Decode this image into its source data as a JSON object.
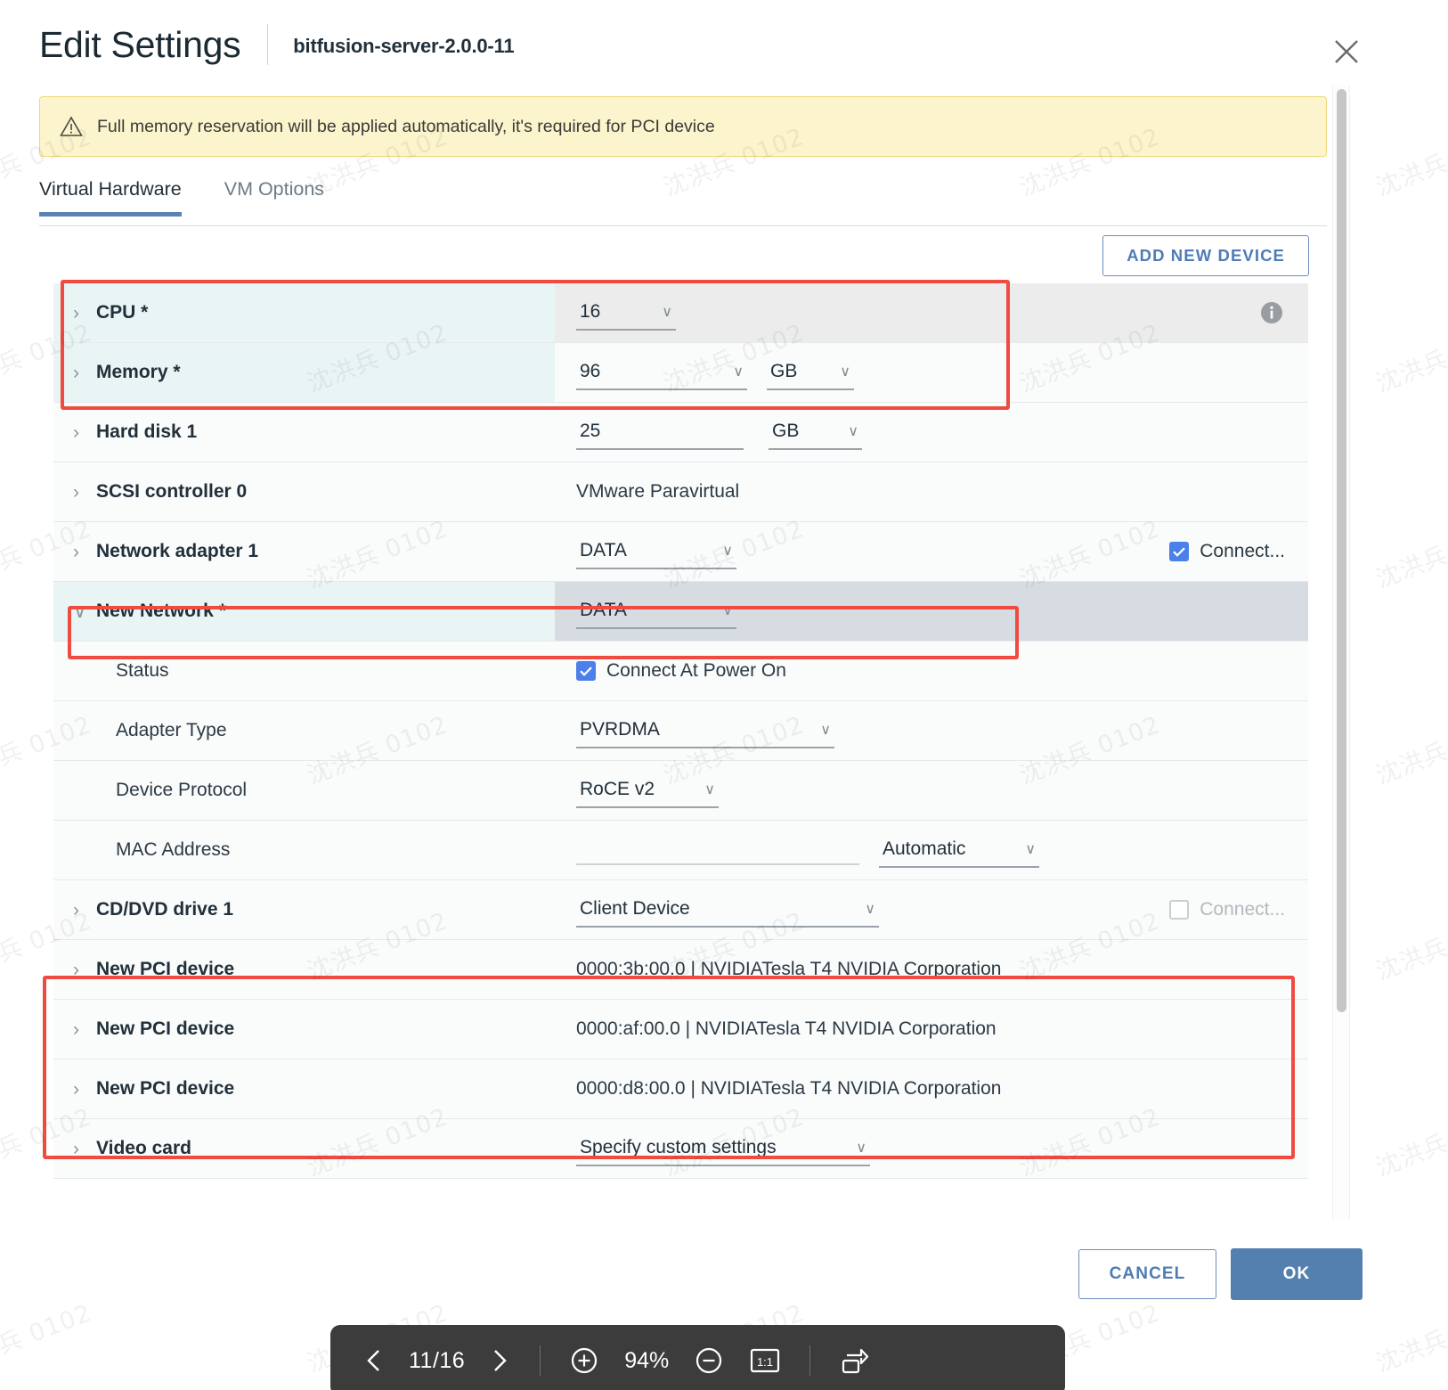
{
  "header": {
    "title": "Edit Settings",
    "subtitle": "bitfusion-server-2.0.0-11",
    "close_icon": "close-icon"
  },
  "alert": {
    "icon": "warning-triangle-icon",
    "text": "Full memory reservation will be applied automatically, it's required for PCI device"
  },
  "tabs": [
    {
      "label": "Virtual Hardware",
      "active": true
    },
    {
      "label": "VM Options",
      "active": false
    }
  ],
  "toolbar_top": {
    "add_new_device": "ADD NEW DEVICE"
  },
  "rows": {
    "cpu": {
      "label": "CPU *",
      "caret": "›",
      "value": "16",
      "chevron": "∨",
      "info_icon": "info-icon"
    },
    "memory": {
      "label": "Memory *",
      "caret": "›",
      "value": "96",
      "chevron": "∨",
      "unit": "GB",
      "unit_chevron": "∨"
    },
    "harddisk": {
      "label": "Hard disk 1",
      "caret": "›",
      "value": "25",
      "unit": "GB",
      "unit_chevron": "∨"
    },
    "scsi": {
      "label": "SCSI controller 0",
      "caret": "›",
      "value": "VMware Paravirtual"
    },
    "netadapter": {
      "label": "Network adapter 1",
      "caret": "›",
      "value": "DATA",
      "chevron": "∨",
      "connect_label": "Connect...",
      "connect_checked": true
    },
    "newnetwork": {
      "label": "New Network *",
      "caret": "∨",
      "value": "DATA",
      "chevron": "∨"
    },
    "status": {
      "label": "Status",
      "checkbox_label": "Connect At Power On",
      "checked": true
    },
    "adapter_type": {
      "label": "Adapter Type",
      "value": "PVRDMA",
      "chevron": "∨"
    },
    "device_protocol": {
      "label": "Device Protocol",
      "value": "RoCE v2",
      "chevron": "∨"
    },
    "mac_address": {
      "label": "MAC Address",
      "mac_value": "",
      "mode": "Automatic",
      "chevron": "∨"
    },
    "cddvd": {
      "label": "CD/DVD drive 1",
      "caret": "›",
      "value": "Client Device",
      "chevron": "∨",
      "connect_label": "Connect...",
      "connect_checked": false
    },
    "pci1": {
      "label": "New PCI device",
      "caret": "›",
      "value": "0000:3b:00.0 | NVIDIATesla T4 NVIDIA Corporation"
    },
    "pci2": {
      "label": "New PCI device",
      "caret": "›",
      "value": "0000:af:00.0 | NVIDIATesla T4 NVIDIA Corporation"
    },
    "pci3": {
      "label": "New PCI device",
      "caret": "›",
      "value": "0000:d8:00.0 | NVIDIATesla T4 NVIDIA Corporation"
    },
    "videocard": {
      "label": "Video card",
      "caret": "›",
      "value": "Specify custom settings",
      "chevron": "∨"
    }
  },
  "footer": {
    "cancel": "CANCEL",
    "ok": "OK"
  },
  "viewer_toolbar": {
    "prev_icon": "chevron-left-icon",
    "page": "11/16",
    "next_icon": "chevron-right-icon",
    "zoom_in_icon": "zoom-in-icon",
    "zoom_level": "94%",
    "zoom_out_icon": "zoom-out-icon",
    "fit_icon": "actual-size-icon",
    "rotate_icon": "rotate-icon"
  },
  "watermark": {
    "text": "沈洪兵 0102"
  },
  "colors": {
    "accent_blue": "#5480b0",
    "link_blue": "#4f7cb5",
    "alert_bg": "#fcf4cc",
    "alert_border": "#ecd97a",
    "highlight_cyan": "#e8f5f4",
    "annotation_red": "#ef4b40",
    "toolbar_dark": "#3c3c3c"
  }
}
